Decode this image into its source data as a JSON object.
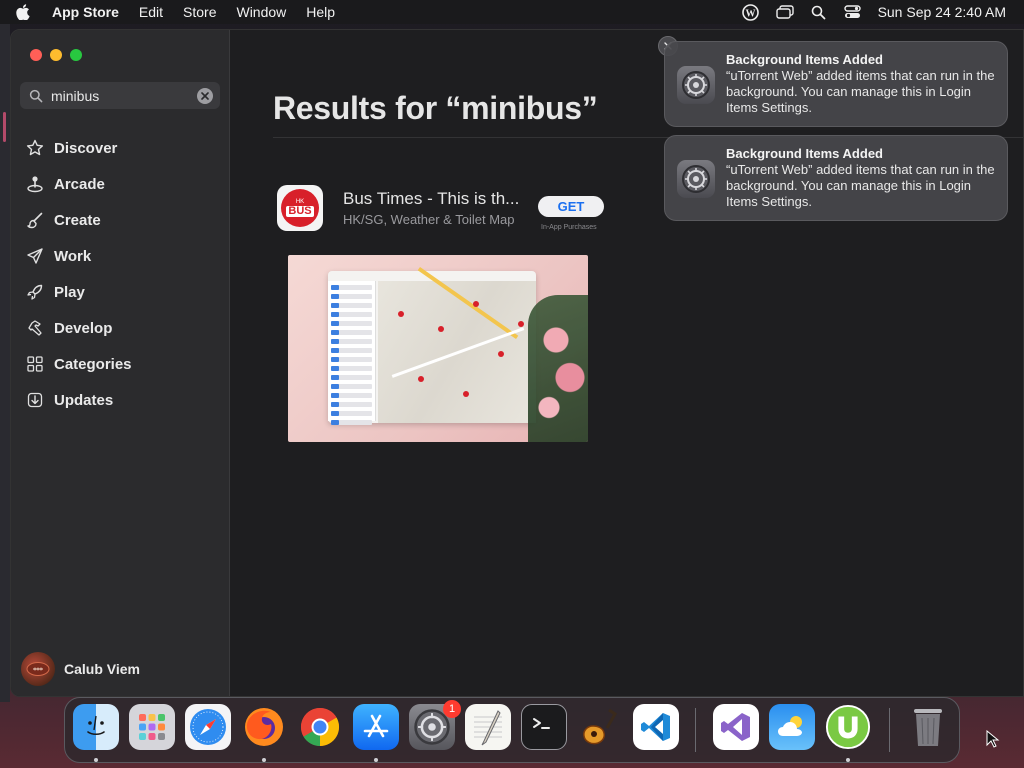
{
  "menubar": {
    "apple_icon": "apple-logo-icon",
    "app_name": "App Store",
    "items": [
      "Edit",
      "Store",
      "Window",
      "Help"
    ],
    "status_icons": [
      "wordpress-icon",
      "screen-mirroring-icon",
      "spotlight-search-icon",
      "control-center-icon"
    ],
    "clock": "Sun Sep 24  2:40 AM"
  },
  "sidebar": {
    "search": {
      "value": "minibus",
      "placeholder": "Search"
    },
    "nav": [
      {
        "label": "Discover",
        "icon": "star-icon"
      },
      {
        "label": "Arcade",
        "icon": "joystick-icon"
      },
      {
        "label": "Create",
        "icon": "paintbrush-icon"
      },
      {
        "label": "Work",
        "icon": "paperplane-icon"
      },
      {
        "label": "Play",
        "icon": "rocket-icon"
      },
      {
        "label": "Develop",
        "icon": "hammer-icon"
      },
      {
        "label": "Categories",
        "icon": "grid-icon"
      },
      {
        "label": "Updates",
        "icon": "download-icon"
      }
    ],
    "user": {
      "name": "Calub Viem"
    }
  },
  "main": {
    "title": "Results for “minibus”",
    "result": {
      "name": "Bus Times - This is th...",
      "subtitle": "HK/SG, Weather & Toilet Map",
      "get_label": "GET",
      "iap_label": "In-App Purchases",
      "icon_hk": "HK",
      "icon_bus": "BUS"
    }
  },
  "notifications": [
    {
      "title": "Background Items Added",
      "body": "“uTorrent Web” added items that can run in the background. You can manage this in Login Items Settings."
    },
    {
      "title": "Background Items Added",
      "body": "“uTorrent Web” added items that can run in the background. You can manage this in Login Items Settings."
    }
  ],
  "dock": {
    "items": [
      {
        "name": "Finder",
        "icon": "finder-icon"
      },
      {
        "name": "Launchpad",
        "icon": "launchpad-icon"
      },
      {
        "name": "Safari",
        "icon": "safari-icon"
      },
      {
        "name": "Firefox",
        "icon": "firefox-icon"
      },
      {
        "name": "Chrome",
        "icon": "chrome-icon"
      },
      {
        "name": "App Store",
        "icon": "app-store-icon"
      },
      {
        "name": "System Settings",
        "icon": "system-settings-icon",
        "badge": "1"
      },
      {
        "name": "TextEdit",
        "icon": "textedit-icon"
      },
      {
        "name": "Terminal",
        "icon": "terminal-icon"
      },
      {
        "name": "GarageBand",
        "icon": "garageband-icon"
      },
      {
        "name": "Visual Studio Code",
        "icon": "vscode-icon"
      },
      {
        "name": "Visual Studio",
        "icon": "visual-studio-icon"
      },
      {
        "name": "Weather",
        "icon": "weather-icon"
      },
      {
        "name": "uTorrent Web",
        "icon": "utorrent-icon"
      },
      {
        "name": "Trash",
        "icon": "trash-icon"
      }
    ]
  },
  "colors": {
    "accent_blue": "#1a6ff0",
    "close_red": "#ff5f57",
    "minimize_yellow": "#febc2e",
    "maximize_green": "#28c840",
    "badge_red": "#ff3b30"
  }
}
